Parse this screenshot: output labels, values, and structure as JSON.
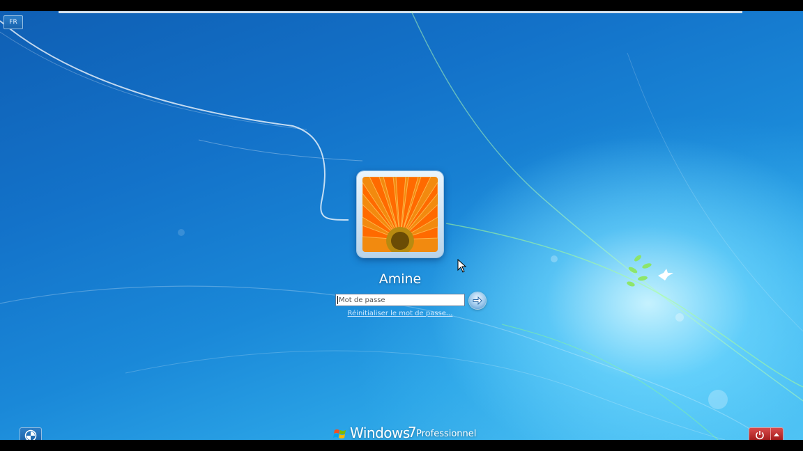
{
  "language_indicator": "FR",
  "user": {
    "name": "Amine"
  },
  "login": {
    "password_placeholder": "Mot de passe",
    "reset_link": "Réinitialiser le mot de passe..."
  },
  "branding": {
    "product": "Windows",
    "version": "7",
    "edition": "Professionnel"
  },
  "icons": {
    "submit": "arrow-right-icon",
    "ease_of_access": "ease-of-access-icon",
    "shutdown": "power-icon",
    "shutdown_options": "triangle-up-icon"
  },
  "colors": {
    "background_dark": "#0f5fb4",
    "background_light": "#4ec0f0",
    "power_button": "#c62828",
    "link": "#cfe9ff"
  }
}
